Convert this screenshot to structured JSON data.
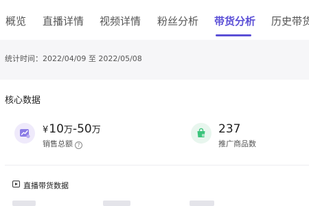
{
  "tabs": [
    {
      "label": "概览"
    },
    {
      "label": "直播详情"
    },
    {
      "label": "视频详情"
    },
    {
      "label": "粉丝分析"
    },
    {
      "label": "带货分析",
      "active": true
    },
    {
      "label": "历史带货"
    }
  ],
  "period": {
    "text": "统计时间：2022/04/09 至 2022/05/08"
  },
  "core": {
    "title": "核心数据",
    "sales": {
      "currency": "¥",
      "low": "10",
      "sep": "-",
      "high": "50",
      "unit": "万",
      "label": "销售总额",
      "help": "?"
    },
    "products": {
      "value": "237",
      "label": "推广商品数"
    }
  },
  "live": {
    "title": "直播带货数据"
  },
  "colors": {
    "accent": "#5b4fd6",
    "purple_soft": "#efeafb",
    "green": "#3cc47c"
  }
}
